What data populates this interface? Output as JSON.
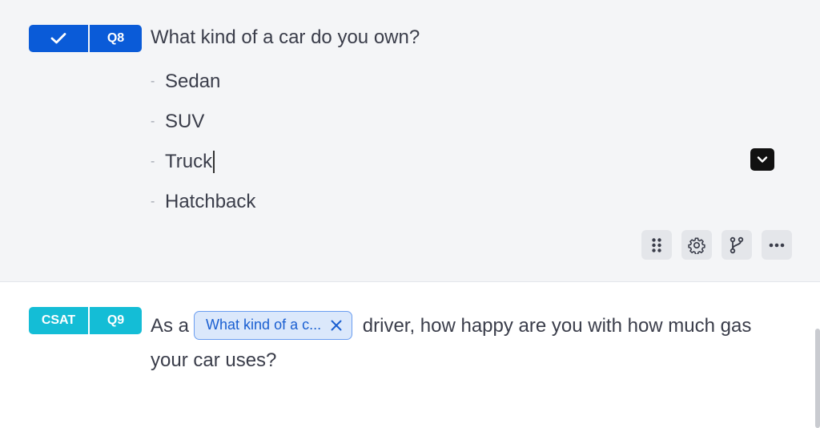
{
  "q8": {
    "type_icon": "checkmark-icon",
    "number": "Q8",
    "title": "What kind of a car do you own?",
    "options": [
      "Sedan",
      "SUV",
      "Truck",
      "Hatchback"
    ],
    "toolbar": [
      "drag-handle-icon",
      "gear-icon",
      "branch-icon",
      "more-icon"
    ]
  },
  "q9": {
    "type": "CSAT",
    "number": "Q9",
    "text_before": "As a",
    "piped_field": "What kind of a c...",
    "text_after": "driver, how happy are you with how much gas your car uses?"
  },
  "colors": {
    "q8_badge": "#0a5bd8",
    "q9_badge": "#14bdd6",
    "chip_bg": "#dbe8fb",
    "chip_border": "#6a9df0"
  }
}
